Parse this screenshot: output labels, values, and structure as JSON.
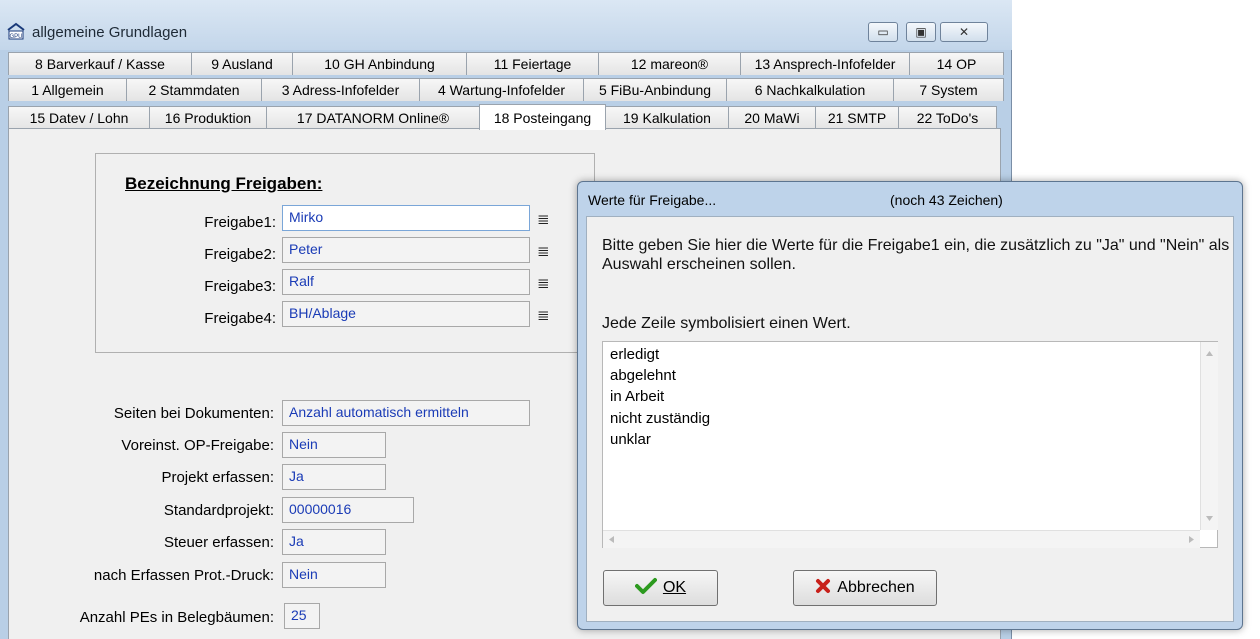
{
  "window": {
    "title": "allgemeine Grundlagen",
    "minimize": "▭",
    "maximize": "▣",
    "close": "✕"
  },
  "tabs": {
    "row1": [
      "8 Barverkauf / Kasse",
      "9 Ausland",
      "10 GH Anbindung",
      "11 Feiertage",
      "12 mareon®",
      "13 Ansprech-Infofelder",
      "14 OP"
    ],
    "row2": [
      "1 Allgemein",
      "2 Stammdaten",
      "3 Adress-Infofelder",
      "4 Wartung-Infofelder",
      "5 FiBu-Anbindung",
      "6 Nachkalkulation",
      "7 System"
    ],
    "row3": [
      "15 Datev / Lohn",
      "16 Produktion",
      "17 DATANORM Online®",
      "18 Posteingang",
      "19 Kalkulation",
      "20 MaWi",
      "21 SMTP",
      "22 ToDo's"
    ]
  },
  "freigaben": {
    "title": "Bezeichnung Freigaben:",
    "items": [
      {
        "label": "Freigabe1:",
        "value": "Mirko"
      },
      {
        "label": "Freigabe2:",
        "value": "Peter"
      },
      {
        "label": "Freigabe3:",
        "value": "Ralf"
      },
      {
        "label": "Freigabe4:",
        "value": "BH/Ablage"
      }
    ],
    "icon": "≣"
  },
  "settings": [
    {
      "label": "Seiten bei Dokumenten:",
      "value": "Anzahl automatisch ermitteln"
    },
    {
      "label": "Voreinst. OP-Freigabe:",
      "value": "Nein"
    },
    {
      "label": "Projekt erfassen:",
      "value": "Ja"
    },
    {
      "label": "Standardprojekt:",
      "value": "00000016"
    },
    {
      "label": "Steuer erfassen:",
      "value": "Ja"
    },
    {
      "label": "nach Erfassen Prot.-Druck:",
      "value": "Nein"
    },
    {
      "label": "Anzahl PEs in Belegbäumen:",
      "value": "25"
    }
  ],
  "dialog": {
    "title": "Werte für Freigabe...",
    "remaining": "(noch 43 Zeichen)",
    "text1": "Bitte geben Sie hier die Werte für die Freigabe1 ein, die zusätzlich zu \"Ja\" und \"Nein\" als Auswahl erscheinen sollen.",
    "text2": "Jede Zeile symbolisiert einen Wert.",
    "lines": [
      "erledigt",
      "abgelehnt",
      "in Arbeit",
      "nicht zuständig",
      "unklar"
    ],
    "ok": "OK",
    "cancel": "Abbrechen"
  }
}
